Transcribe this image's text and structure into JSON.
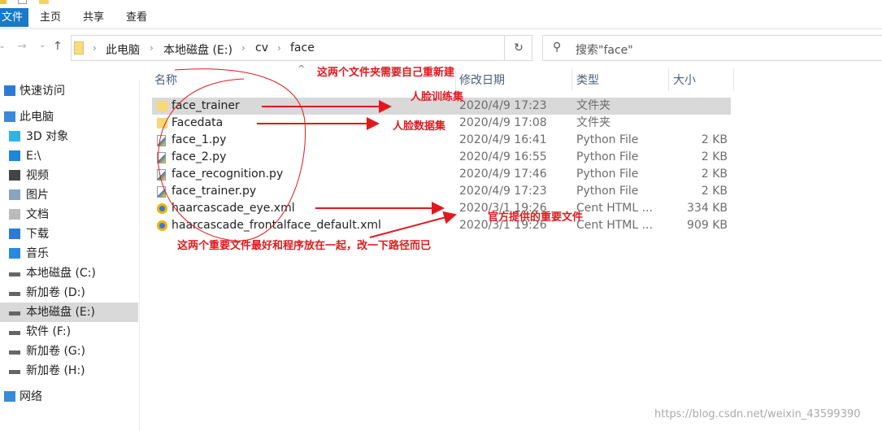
{
  "ribbon": {
    "tabs": [
      "文件",
      "主页",
      "共享",
      "查看"
    ]
  },
  "address": {
    "crumbs": [
      "此电脑",
      "本地磁盘 (E:)",
      "cv",
      "face"
    ]
  },
  "search": {
    "placeholder": "搜索\"face\""
  },
  "sidebar": {
    "items": [
      {
        "label": "快速访问",
        "icon": "star-icon"
      },
      {
        "label": "此电脑",
        "icon": "computer-icon"
      },
      {
        "label": "3D 对象",
        "icon": "cube-icon"
      },
      {
        "label": "E:\\",
        "icon": "monitor-icon"
      },
      {
        "label": "视频",
        "icon": "film-icon"
      },
      {
        "label": "图片",
        "icon": "picture-icon"
      },
      {
        "label": "文档",
        "icon": "document-icon"
      },
      {
        "label": "下载",
        "icon": "download-icon"
      },
      {
        "label": "音乐",
        "icon": "music-icon"
      },
      {
        "label": "本地磁盘 (C:)",
        "icon": "drive-icon"
      },
      {
        "label": "新加卷 (D:)",
        "icon": "drive-icon"
      },
      {
        "label": "本地磁盘 (E:)",
        "icon": "drive-icon",
        "selected": true
      },
      {
        "label": "软件 (F:)",
        "icon": "drive-icon"
      },
      {
        "label": "新加卷 (G:)",
        "icon": "drive-icon"
      },
      {
        "label": "新加卷 (H:)",
        "icon": "drive-icon"
      },
      {
        "label": "网络",
        "icon": "network-icon"
      }
    ]
  },
  "columns": {
    "name": "名称",
    "date": "修改日期",
    "type": "类型",
    "size": "大小"
  },
  "files": [
    {
      "name": "face_trainer",
      "date": "2020/4/9 17:23",
      "type": "文件夹",
      "size": "",
      "icon": "folder-icon",
      "selected": true
    },
    {
      "name": "Facedata",
      "date": "2020/4/9 17:08",
      "type": "文件夹",
      "size": "",
      "icon": "folder-icon"
    },
    {
      "name": "face_1.py",
      "date": "2020/4/9 16:41",
      "type": "Python File",
      "size": "2 KB",
      "icon": "python-file-icon"
    },
    {
      "name": "face_2.py",
      "date": "2020/4/9 16:55",
      "type": "Python File",
      "size": "2 KB",
      "icon": "python-file-icon"
    },
    {
      "name": "face_recognition.py",
      "date": "2020/4/9 17:46",
      "type": "Python File",
      "size": "2 KB",
      "icon": "python-file-icon"
    },
    {
      "name": "face_trainer.py",
      "date": "2020/4/9 17:23",
      "type": "Python File",
      "size": "2 KB",
      "icon": "python-file-icon"
    },
    {
      "name": "haarcascade_eye.xml",
      "date": "2020/3/1 19:26",
      "type": "Cent HTML ...",
      "size": "334 KB",
      "icon": "browser-file-icon"
    },
    {
      "name": "haarcascade_frontalface_default.xml",
      "date": "2020/3/1 19:26",
      "type": "Cent HTML ...",
      "size": "909 KB",
      "icon": "browser-file-icon"
    }
  ],
  "annotations": {
    "folders_note": "这两个文件夹需要自己重新建",
    "trainer_note": "人脸训练集",
    "data_note": "人脸数据集",
    "xml_note": "官方提供的重要文件",
    "xml_advice": "这两个重要文件最好和程序放在一起，改一下路径而已"
  },
  "watermark": "https://blog.csdn.net/weixin_43599390",
  "colors": {
    "accent": "#1979ca",
    "annotation": "#e0191f",
    "selected": "#d9d9d9"
  }
}
